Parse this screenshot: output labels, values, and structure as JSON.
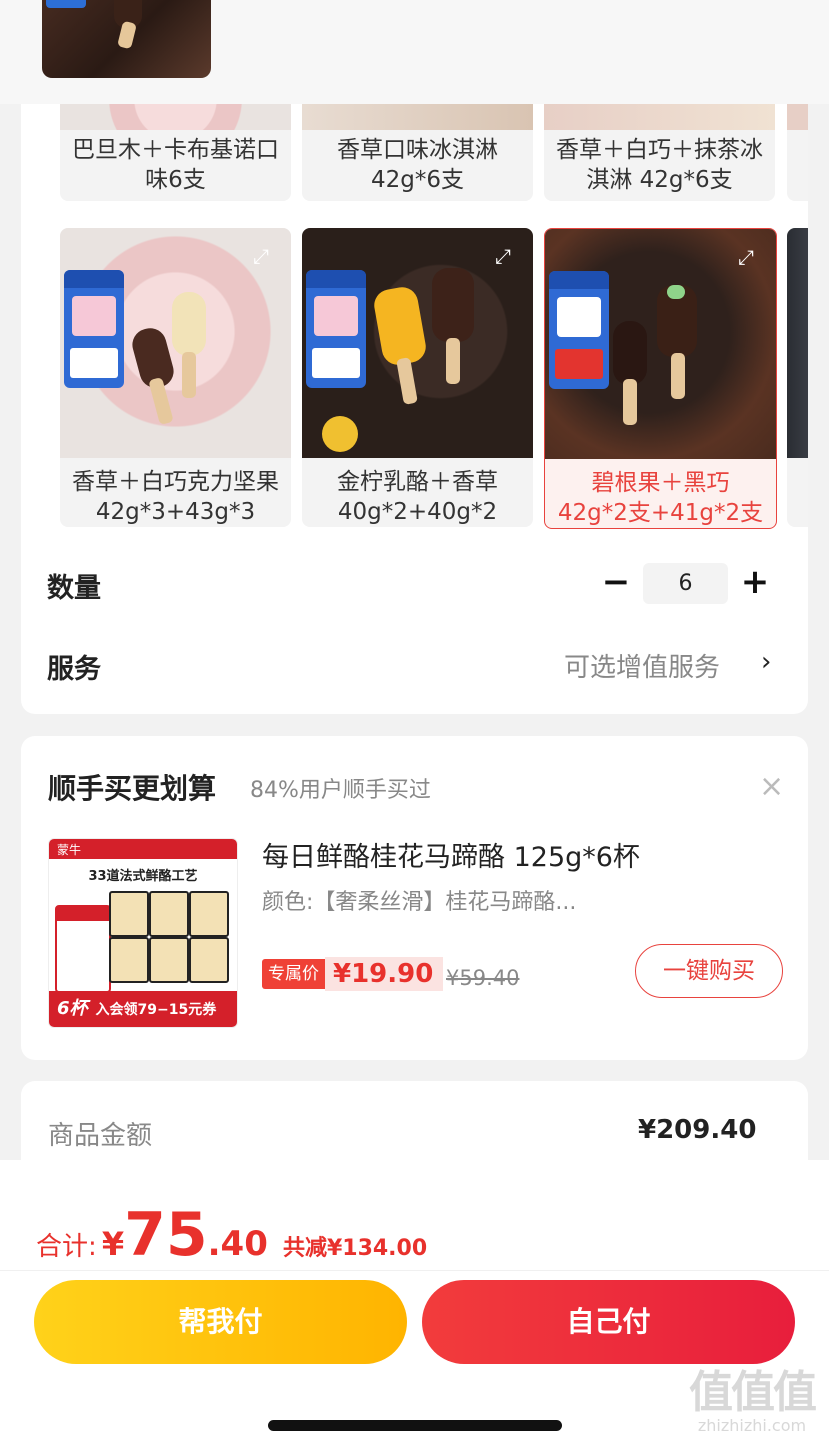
{
  "header": {
    "cut_text": ""
  },
  "variants": {
    "row1": [
      {
        "label_line1": "巴旦木＋卡布基诺口",
        "label_line2": "味6支"
      },
      {
        "label_line1": "香草口味冰淇淋",
        "label_line2": "42g*6支"
      },
      {
        "label_line1": "香草＋白巧＋抹茶冰",
        "label_line2": "淇淋 42g*6支"
      }
    ],
    "row2": [
      {
        "label_line1": "香草＋白巧克力坚果",
        "label_line2": "42g*3+43g*3",
        "selected": false
      },
      {
        "label_line1": "金柠乳酪＋香草",
        "label_line2": "40g*2+40g*2",
        "selected": false
      },
      {
        "label_line1": "碧根果＋黑巧",
        "label_line2": "42g*2支+41g*2支",
        "selected": true
      }
    ]
  },
  "quantity": {
    "label": "数量",
    "value": "6",
    "minus": "−",
    "plus": "+"
  },
  "service": {
    "label": "服务",
    "value": "可选增值服务",
    "chevron": "›"
  },
  "recommend": {
    "title": "顺手买更划算",
    "subtitle": "84%用户顺手买过",
    "close": "×",
    "product": {
      "brand": "蒙牛",
      "thumb_title": "33道法式鲜酪工艺",
      "thumb_footer": "入会领79−15元券",
      "thumb_count": "6杯",
      "name": "每日鲜酪桂花马蹄酪 125g*6杯",
      "spec": "颜色:【奢柔丝滑】桂花马蹄酪...",
      "price_badge": "专属价",
      "price": "¥19.90",
      "old_price": "¥59.40",
      "buy_button": "一键购买"
    }
  },
  "amount": {
    "label": "商品金额",
    "value": "¥209.40"
  },
  "bottom": {
    "total_label": "合计:",
    "currency": "¥",
    "total_int": "75",
    "total_dec": ".40",
    "saved": "共减¥134.00",
    "btn_help": "帮我付",
    "btn_self": "自己付"
  },
  "watermark": {
    "big": "值值值",
    "small": "zhizhizhi.com"
  }
}
